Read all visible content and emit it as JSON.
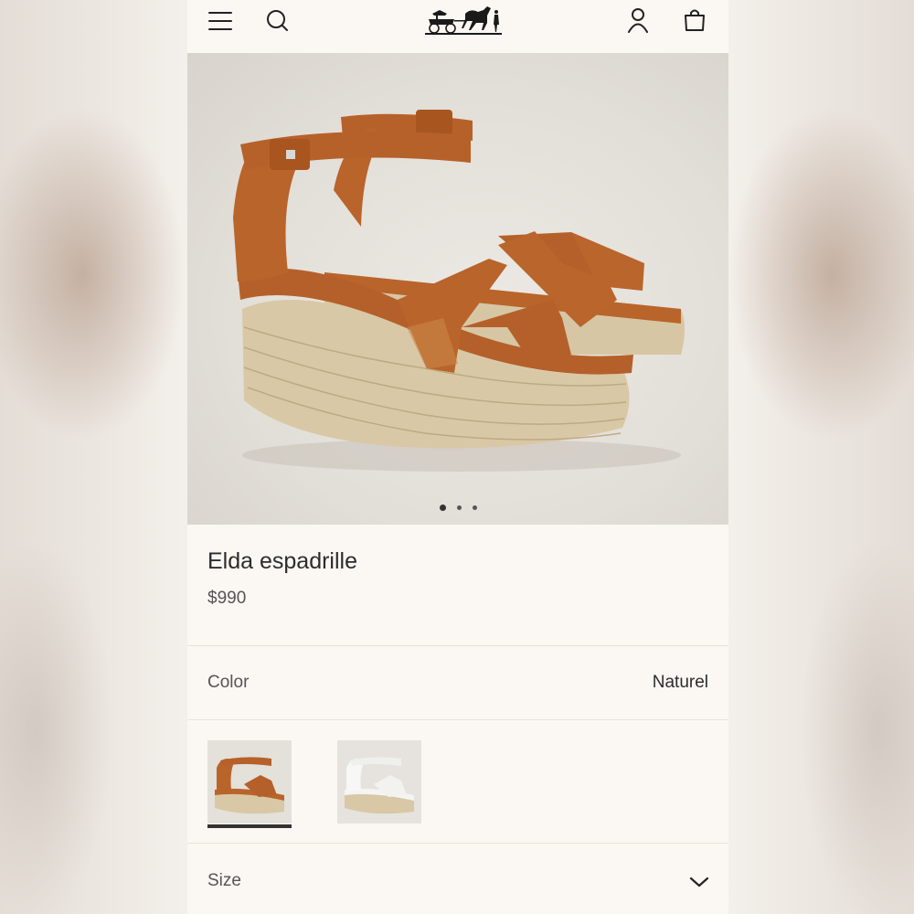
{
  "header": {
    "menu_icon": "hamburger-menu-icon",
    "search_icon": "search-icon",
    "logo_icon": "horse-carriage-logo",
    "account_icon": "user-icon",
    "bag_icon": "shopping-bag-icon"
  },
  "gallery": {
    "slide_count": 3,
    "active_slide": 1
  },
  "product": {
    "name": "Elda espadrille",
    "price": "$990"
  },
  "color": {
    "label": "Color",
    "selected": "Naturel",
    "swatches": [
      {
        "color": "#b9642a",
        "selected": true
      },
      {
        "color": "#f2f2f0",
        "selected": false
      }
    ]
  },
  "size": {
    "label": "Size",
    "icon": "chevron-down-icon"
  },
  "colors": {
    "background": "#fbf8f3",
    "text": "#2c2c2c",
    "muted": "#555555",
    "suede": "#b9642a"
  }
}
